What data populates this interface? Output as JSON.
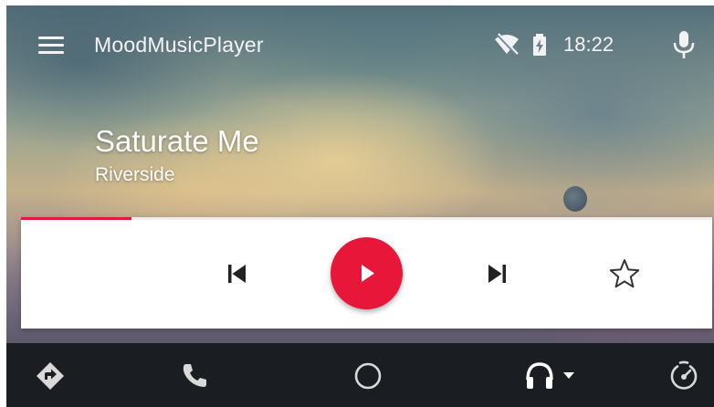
{
  "app": {
    "title": "MoodMusicPlayer"
  },
  "status_bar": {
    "time": "18:22",
    "icons": [
      "wifi-off-icon",
      "battery-charging-icon",
      "microphone-icon"
    ]
  },
  "now_playing": {
    "title": "Saturate Me",
    "artist": "Riverside",
    "progress_fraction": 0.16,
    "state": "paused"
  },
  "controls": {
    "buttons": [
      "skip-previous-icon",
      "play-icon",
      "skip-next-icon",
      "star-outline-icon"
    ]
  },
  "navigation": {
    "items": [
      "navigation-icon",
      "phone-icon",
      "home-icon",
      "headphones-icon",
      "exit-icon"
    ],
    "active": "headphones-icon"
  },
  "colors": {
    "accent": "#e8173a",
    "nav_background": "#1a1d22",
    "card": "#ffffff",
    "icon_light": "#f2f2f2",
    "icon_dark": "#222222"
  }
}
